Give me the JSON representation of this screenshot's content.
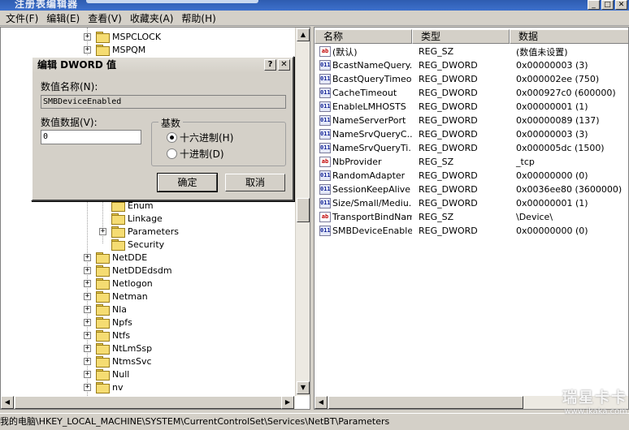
{
  "window": {
    "title": "注册表编辑器"
  },
  "menu": [
    "文件(F)",
    "编辑(E)",
    "查看(V)",
    "收藏夹(A)",
    "帮助(H)"
  ],
  "tree": {
    "items_top": [
      "MSPCLOCK",
      "MSPQM"
    ],
    "items_mid": [
      "Enum",
      "Linkage",
      "Parameters",
      "Security"
    ],
    "items_bottom": [
      "NetDDE",
      "NetDDEdsdm",
      "Netlogon",
      "Netman",
      "Nla",
      "Npfs",
      "Ntfs",
      "NtLmSsp",
      "NtmsSvc",
      "Null",
      "nv"
    ]
  },
  "list": {
    "headers": [
      "名称",
      "类型",
      "数据"
    ],
    "rows": [
      {
        "icon": "ab",
        "name": "(默认)",
        "type": "REG_SZ",
        "data": "(数值未设置)"
      },
      {
        "icon": "dword",
        "name": "BcastNameQuery...",
        "type": "REG_DWORD",
        "data": "0x00000003 (3)"
      },
      {
        "icon": "dword",
        "name": "BcastQueryTimeout",
        "type": "REG_DWORD",
        "data": "0x000002ee (750)"
      },
      {
        "icon": "dword",
        "name": "CacheTimeout",
        "type": "REG_DWORD",
        "data": "0x000927c0 (600000)"
      },
      {
        "icon": "dword",
        "name": "EnableLMHOSTS",
        "type": "REG_DWORD",
        "data": "0x00000001 (1)"
      },
      {
        "icon": "dword",
        "name": "NameServerPort",
        "type": "REG_DWORD",
        "data": "0x00000089 (137)"
      },
      {
        "icon": "dword",
        "name": "NameSrvQueryC...",
        "type": "REG_DWORD",
        "data": "0x00000003 (3)"
      },
      {
        "icon": "dword",
        "name": "NameSrvQueryTi...",
        "type": "REG_DWORD",
        "data": "0x000005dc (1500)"
      },
      {
        "icon": "ab",
        "name": "NbProvider",
        "type": "REG_SZ",
        "data": "_tcp"
      },
      {
        "icon": "dword",
        "name": "RandomAdapter",
        "type": "REG_DWORD",
        "data": "0x00000000 (0)"
      },
      {
        "icon": "dword",
        "name": "SessionKeepAlive",
        "type": "REG_DWORD",
        "data": "0x0036ee80 (3600000)"
      },
      {
        "icon": "dword",
        "name": "Size/Small/Mediu...",
        "type": "REG_DWORD",
        "data": "0x00000001 (1)"
      },
      {
        "icon": "ab",
        "name": "TransportBindName",
        "type": "REG_SZ",
        "data": "\\Device\\"
      },
      {
        "icon": "dword",
        "name": "SMBDeviceEnabled",
        "type": "REG_DWORD",
        "data": "0x00000000 (0)"
      }
    ]
  },
  "dialog": {
    "title": "编辑 DWORD 值",
    "help_glyph": "?",
    "close_glyph": "✕",
    "name_label": "数值名称(N):",
    "name_value": "SMBDeviceEnabled",
    "data_label": "数值数据(V):",
    "data_value": "0",
    "base_title": "基数",
    "radio_hex": "十六进制(H)",
    "radio_dec": "十进制(D)",
    "ok": "确定",
    "cancel": "取消"
  },
  "statusbar": {
    "path": "我的电脑\\HKEY_LOCAL_MACHINE\\SYSTEM\\CurrentControlSet\\Services\\NetBT\\Parameters"
  },
  "watermark": {
    "line1": "瑞星卡卡",
    "line2": "www.ikaka.com"
  },
  "colors": {
    "titlebar": "#2e5cb0",
    "face": "#d4d0c8",
    "folder": "#f5dc72"
  }
}
